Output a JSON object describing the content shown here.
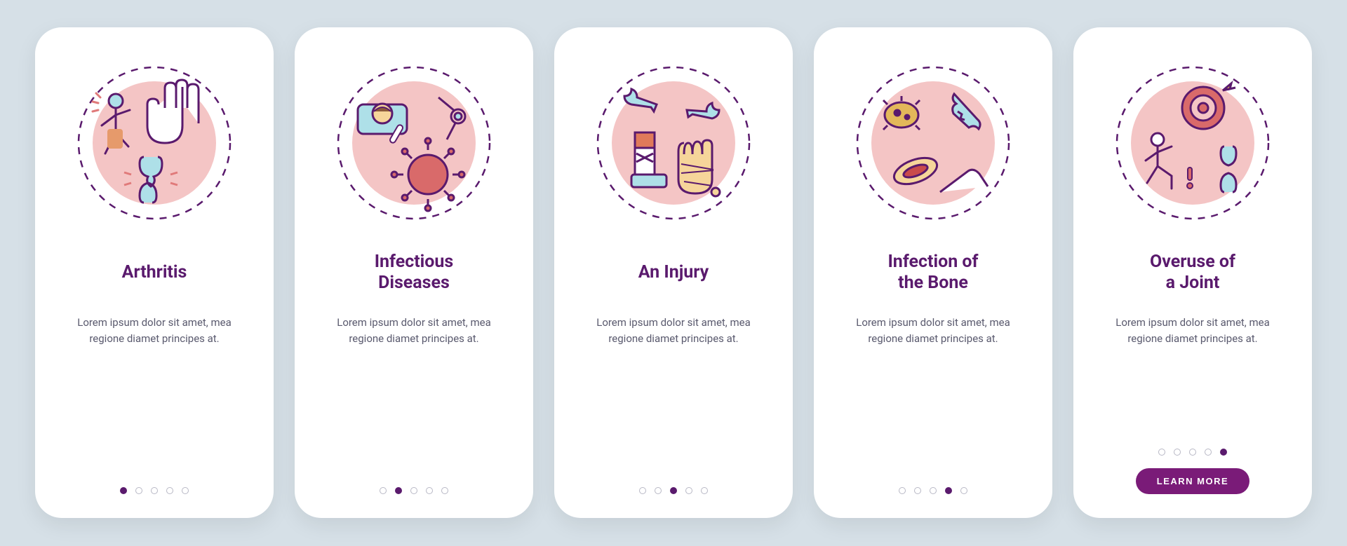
{
  "cards": [
    {
      "title": "Arthritis",
      "desc": "Lorem ipsum dolor sit amet, mea regione diamet principes at.",
      "icon": "arthritis"
    },
    {
      "title": "Infectious\nDiseases",
      "desc": "Lorem ipsum dolor sit amet, mea regione diamet principes at.",
      "icon": "infectious"
    },
    {
      "title": "An Injury",
      "desc": "Lorem ipsum dolor sit amet, mea regione diamet principes at.",
      "icon": "injury"
    },
    {
      "title": "Infection of\nthe Bone",
      "desc": "Lorem ipsum dolor sit amet, mea regione diamet principes at.",
      "icon": "bone-infection"
    },
    {
      "title": "Overuse of\na Joint",
      "desc": "Lorem ipsum dolor sit amet, mea regione diamet principes at.",
      "icon": "overuse"
    }
  ],
  "cta_label": "LEARN MORE",
  "total_dots": 5
}
